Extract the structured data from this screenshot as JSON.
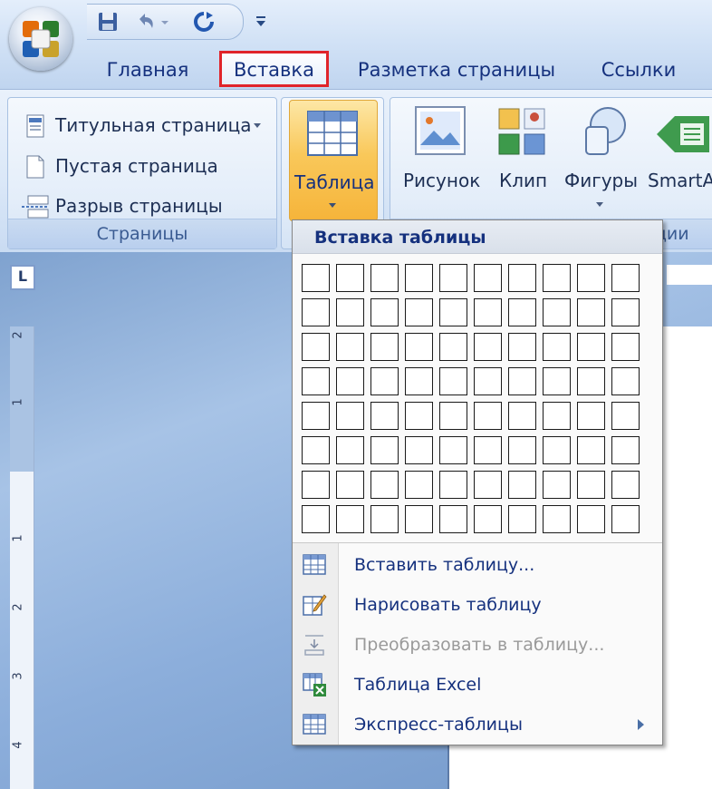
{
  "tabs": {
    "home": "Главная",
    "insert": "Вставка",
    "page_layout": "Разметка страницы",
    "references": "Ссылки"
  },
  "ribbon": {
    "pages_group": {
      "cover_page": "Титульная страница",
      "blank_page": "Пустая страница",
      "page_break": "Разрыв страницы",
      "label": "Страницы"
    },
    "table_button": "Таблица",
    "illustrations": {
      "picture": "Рисунок",
      "clip": "Клип",
      "shapes": "Фигуры",
      "smartart": "SmartA",
      "label_partial": "ции"
    }
  },
  "ruler": {
    "corner": "L",
    "numbers": [
      "2",
      "1",
      "1",
      "2",
      "3",
      "4"
    ]
  },
  "menu": {
    "title": "Вставка таблицы",
    "grid": {
      "columns": 10,
      "rows": 8
    },
    "items": [
      {
        "label": "Вставить таблицу...",
        "icon": "insert-table-icon",
        "enabled": true,
        "submenu": false
      },
      {
        "label": "Нарисовать таблицу",
        "icon": "draw-table-icon",
        "enabled": true,
        "submenu": false
      },
      {
        "label": "Преобразовать в таблицу...",
        "icon": "convert-text-icon",
        "enabled": false,
        "submenu": false
      },
      {
        "label": "Таблица Excel",
        "icon": "excel-table-icon",
        "enabled": true,
        "submenu": false
      },
      {
        "label": "Экспресс-таблицы",
        "icon": "quick-tables-icon",
        "enabled": true,
        "submenu": true
      }
    ]
  },
  "colors": {
    "accent": "#15317e",
    "highlight_border": "#e0242a",
    "table_button_active": "#f6c465"
  }
}
